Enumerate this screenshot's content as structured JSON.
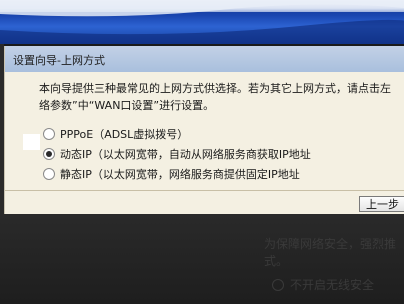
{
  "dialog": {
    "title": "设置向导-上网方式",
    "intro_line_1": "本向导提供三种最常见的上网方式供选择。若为其它上网方式，请点击左",
    "intro_line_2": "络参数”中“WAN口设置”进行设置。",
    "options": [
      {
        "label": "PPPoE（ADSL虚拟拨号）",
        "selected": false
      },
      {
        "label": "动态IP（以太网宽带，自动从网络服务商获取IP地址",
        "selected": true
      },
      {
        "label": "静态IP（以太网宽带，网络服务商提供固定IP地址",
        "selected": false
      }
    ],
    "prev_button": "上一步"
  },
  "background": {
    "text_line_1": "为保障网络安全，强烈推",
    "text_line_2": "式。",
    "option_label": "不开启无线安全"
  },
  "colors": {
    "banner": "#1a46b0",
    "dialog_bg": "#f4f0e2",
    "title_bar": "#b3c6e1"
  }
}
